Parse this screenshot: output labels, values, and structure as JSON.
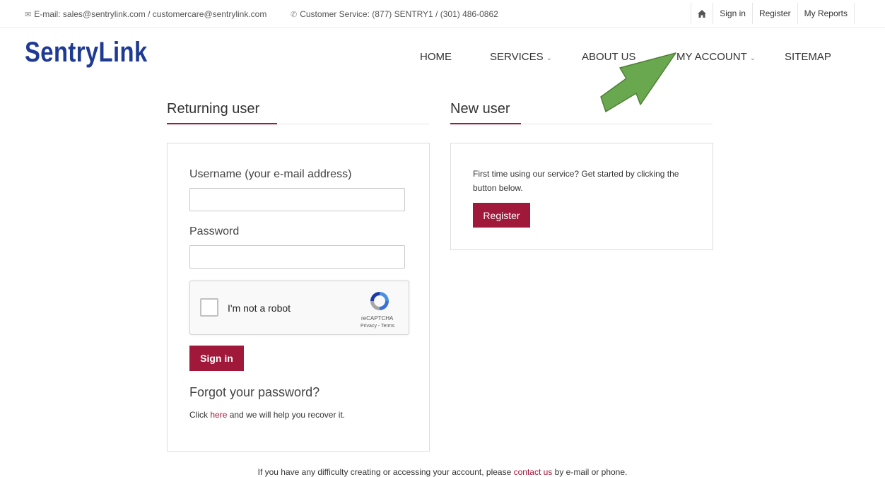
{
  "topbar": {
    "email_text": "E-mail: sales@sentrylink.com / customercare@sentrylink.com",
    "phone_text": "Customer Service: (877) SENTRY1 / (301) 486-0862",
    "links": [
      "Sign in",
      "Register",
      "My Reports"
    ]
  },
  "logo": {
    "text": "SentryLink"
  },
  "nav": {
    "home": "HOME",
    "services": "SERVICES",
    "about": "ABOUT US",
    "account": "MY ACCOUNT",
    "sitemap": "SITEMAP"
  },
  "returning": {
    "title": "Returning user",
    "username_label": "Username (your e-mail address)",
    "username_value": "",
    "password_label": "Password",
    "password_value": "",
    "captcha_label": "I'm not a robot",
    "captcha_brand": "reCAPTCHA",
    "captcha_terms": "Privacy - Terms",
    "signin_button": "Sign in",
    "forgot_title": "Forgot your password?",
    "recover_prefix": "Click ",
    "recover_link": "here",
    "recover_suffix": " and we will help you recover it."
  },
  "newuser": {
    "title": "New user",
    "text": "First time using our service? Get started by clicking the button below.",
    "register_button": "Register"
  },
  "footer": {
    "prefix": "If you have any difficulty creating or accessing your account, please ",
    "link": "contact us",
    "suffix": " by e-mail or phone."
  },
  "colors": {
    "accent": "#a0183a",
    "logo": "#1f3a93",
    "arrow": "#6aa84f"
  }
}
